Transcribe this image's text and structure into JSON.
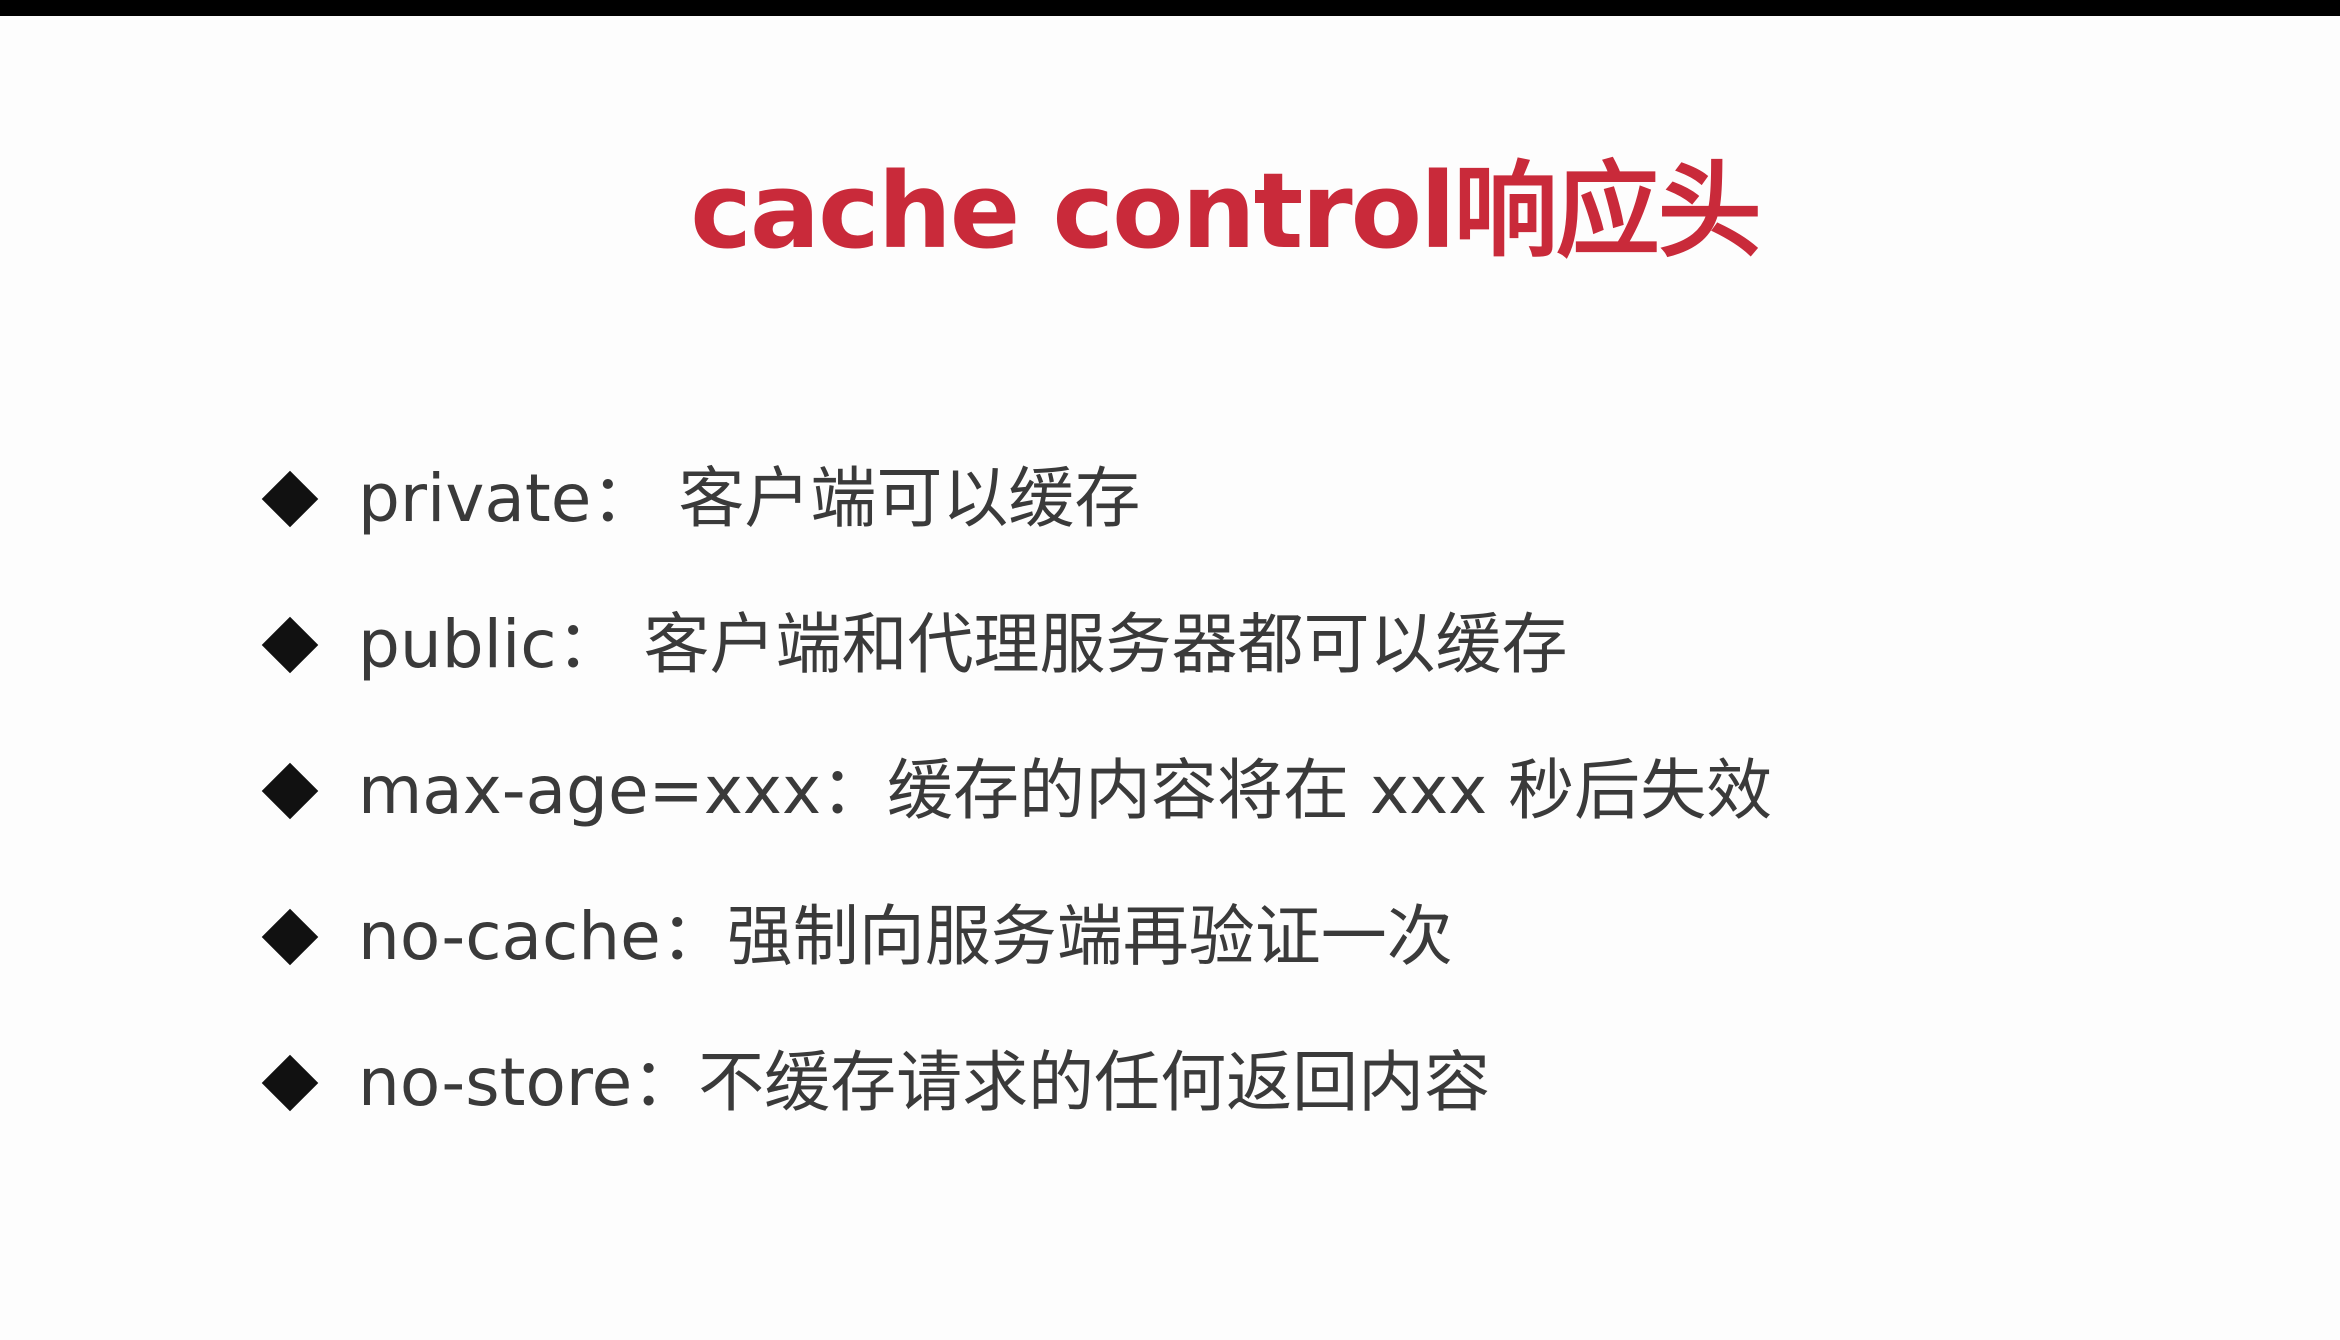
{
  "slide": {
    "title": "cache control响应头",
    "bullets": [
      {
        "text": "private： 客户端可以缓存"
      },
      {
        "text": "public： 客户端和代理服务器都可以缓存"
      },
      {
        "text": "max-age=xxx：缓存的内容将在 xxx 秒后失效"
      },
      {
        "text": "no-cache：强制向服务端再验证一次"
      },
      {
        "text": "no-store：不缓存请求的任何返回内容"
      }
    ]
  },
  "colors": {
    "title": "#c92a3a",
    "text": "#3a3a3a",
    "bullet": "#111111",
    "top_bar": "#000000"
  },
  "icons": {
    "bullet_icon": "diamond-bullet-icon"
  }
}
